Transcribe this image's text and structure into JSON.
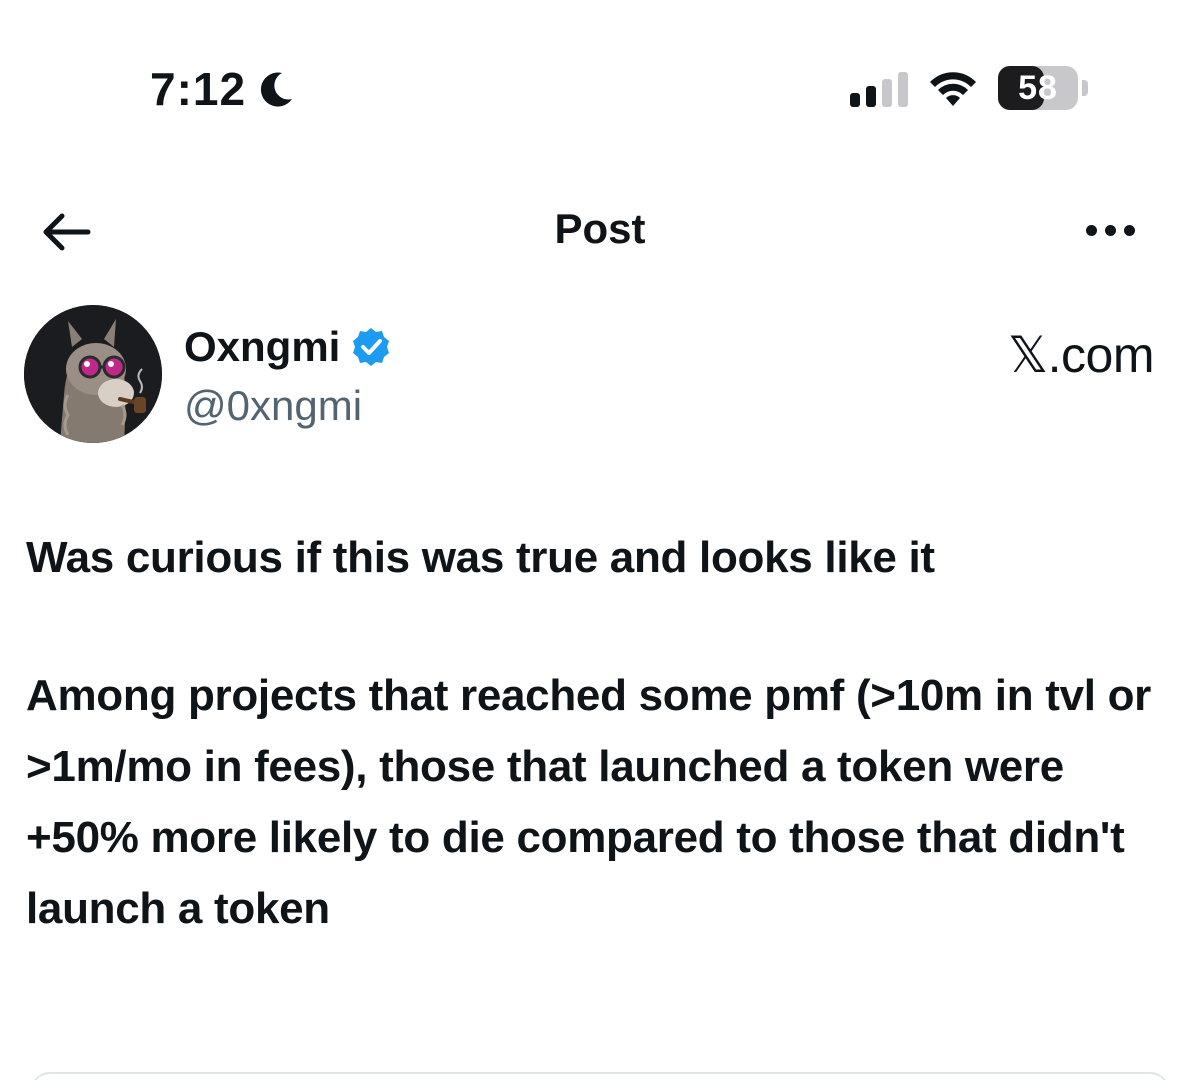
{
  "status_bar": {
    "time": "7:12",
    "moon_icon": "moon-icon",
    "signal_icon": "cellular-signal-icon",
    "signal_bars_active": 2,
    "wifi_icon": "wifi-icon",
    "battery_percent": "58",
    "battery_level": 0.58
  },
  "header": {
    "back_icon": "back-arrow-icon",
    "title": "Post",
    "more_icon": "more-horizontal-icon"
  },
  "author": {
    "display_name": "Oxngmi",
    "handle": "@0xngmi",
    "verified_icon": "verified-badge-icon",
    "avatar_icon": "llama-avatar-icon"
  },
  "site_label": "𝕏.com",
  "post": {
    "paragraph_1": "Was curious if this was true and looks like it",
    "paragraph_2": "Among projects that reached some pmf (>10m in tvl or >1m/mo in fees), those that launched a token were +50% more likely to die compared to those that didn't launch a token"
  },
  "colors": {
    "text": "#0f1419",
    "secondary_text": "#536471",
    "verified_blue": "#1d9bf0",
    "background": "#ffffff"
  }
}
